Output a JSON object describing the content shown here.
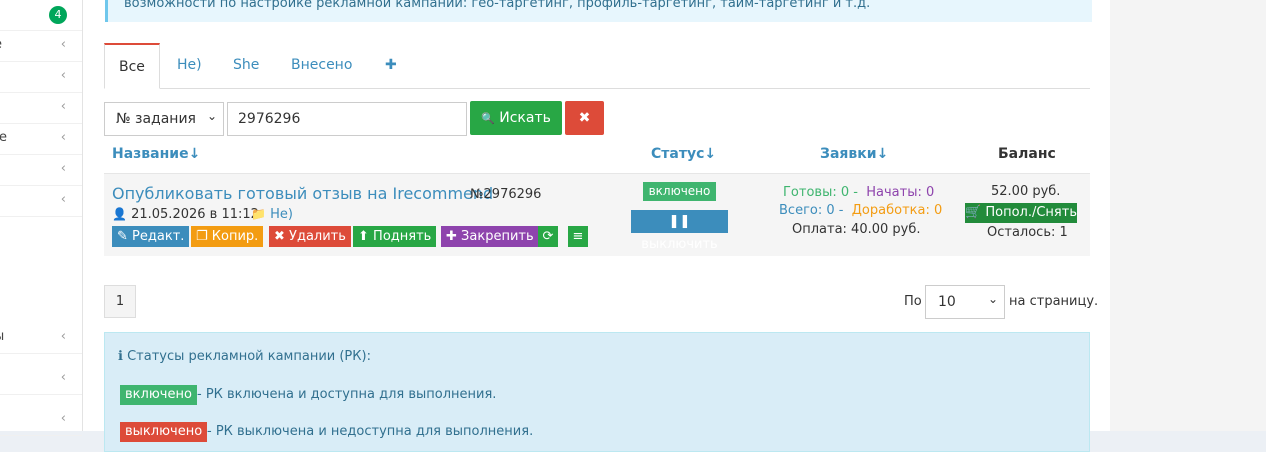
{
  "sidebar": {
    "badge": "4",
    "items": [
      {
        "label": "e"
      },
      {
        "label": ""
      },
      {
        "label": ""
      },
      {
        "label": "re"
      },
      {
        "label": ""
      },
      {
        "label": ""
      },
      {
        "label": "ы"
      },
      {
        "label": ""
      },
      {
        "label": ""
      }
    ],
    "chevron": "‹"
  },
  "info_top": "возможности по настройке рекламной кампании: гео-таргетинг, профиль-таргетинг, тайм-таргетинг и т.д.",
  "tabs": [
    {
      "label": "Все",
      "active": true
    },
    {
      "label": "Не)"
    },
    {
      "label": "She"
    },
    {
      "label": "Внесено"
    },
    {
      "label": "✚"
    }
  ],
  "filter": {
    "field": "№ задания",
    "caret": "⌄",
    "value": "2976296",
    "search_label": "Искать",
    "search_icon": "🔍",
    "clear_icon": "✖"
  },
  "table_headers": {
    "name": "Название",
    "status": "Статус",
    "requests": "Заявки",
    "balance": "Баланс",
    "sort_icon": "↓"
  },
  "task": {
    "title": "Опубликовать готовый отзыв на Irecommend",
    "number": "№2976296",
    "date": "21.05.2026 в 11:12",
    "folder": "Не)",
    "actions": {
      "edit": "Редакт.",
      "copy": "Копир.",
      "delete": "Удалить",
      "raise": "Поднять",
      "pin": "Закрепить"
    },
    "status_badge": "включено",
    "toggle_button": "выключить",
    "requests": {
      "ready_label": "Готовы:",
      "ready": "0",
      "started_label": "Начаты:",
      "started": "0",
      "total_label": "Всего:",
      "total": "0",
      "rework_label": "Доработка:",
      "rework": "0",
      "payment": "Оплата: 40.00 руб."
    },
    "balance": "52.00 руб.",
    "topup_button": "Попол./Снять",
    "remaining": "Осталось: 1"
  },
  "pagination": {
    "current_page": "1",
    "per_page_prefix": "По",
    "per_page_value": "10",
    "per_page_suffix": "на страницу."
  },
  "legend": {
    "title": "Статусы рекламной кампании (РК):",
    "on_badge": "включено",
    "on_text": "- РК включена и доступна для выполнения.",
    "off_badge": "выключено",
    "off_text": "- РК выключена и недоступна для выполнения."
  },
  "colors": {
    "accent_blue": "#3c8dbc",
    "success": "#28a745",
    "danger": "#dd4b39",
    "warning": "#f39c12",
    "purple": "#8e44ad"
  }
}
